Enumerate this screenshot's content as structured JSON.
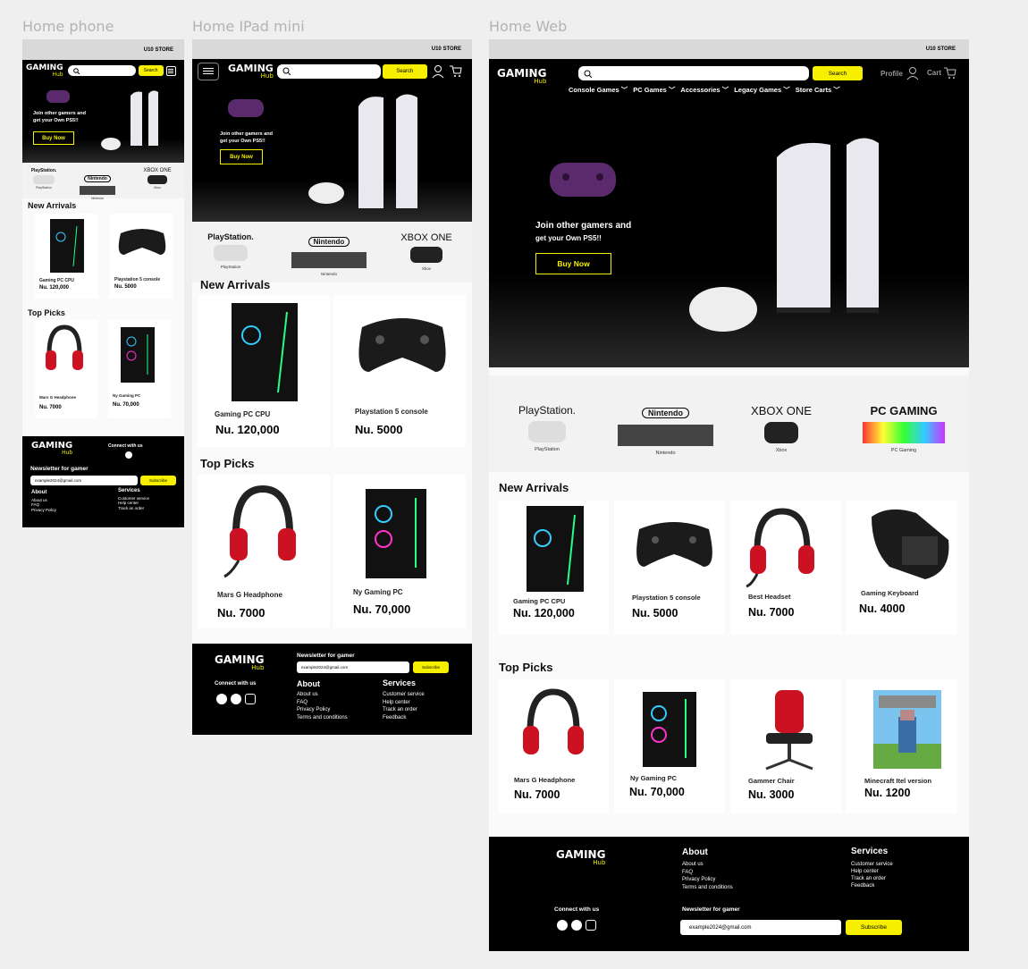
{
  "frames": {
    "phone_title": "Home phone",
    "ipad_title": "Home IPad mini",
    "web_title": "Home Web"
  },
  "store_name": "U10 STORE",
  "logo": {
    "main": "GAMING",
    "sub": "Hub"
  },
  "search_button": "Search",
  "hero": {
    "line1": "Join other gamers and",
    "line2": "get your Own PS5!!",
    "cta": "Buy Now"
  },
  "nav": {
    "profile": "Profile",
    "cart": "Cart",
    "menu": [
      "Console Games",
      "PC Games",
      "Accessories",
      "Legacy Games",
      "Store Carts"
    ]
  },
  "brands": [
    {
      "logo": "PlayStation.",
      "caption": "PlayStation"
    },
    {
      "logo": "Nintendo",
      "caption": "Nintendo"
    },
    {
      "logo": "XBOX ONE",
      "caption": "Xbox"
    },
    {
      "logo": "PC GAMING",
      "caption": "PC Gaming"
    }
  ],
  "sections": {
    "new_arrivals": "New Arrivals",
    "top_picks": "Top Picks"
  },
  "new_arrivals": [
    {
      "name": "Gaming PC CPU",
      "price": "Nu. 120,000",
      "icon": "gaming-pc-icon"
    },
    {
      "name": "Playstation 5 console",
      "price": "Nu. 5000",
      "icon": "controller-icon"
    },
    {
      "name": "Best Headset",
      "price": "Nu. 7000",
      "icon": "headset-icon"
    },
    {
      "name": "Gaming Keyboard",
      "price": "Nu. 4000",
      "icon": "keypad-icon"
    }
  ],
  "top_picks": [
    {
      "name": "Mars G Headphone",
      "price": "Nu. 7000",
      "icon": "headset-icon"
    },
    {
      "name": "Ny Gaming PC",
      "price": "Nu. 70,000",
      "icon": "gaming-pc-icon"
    },
    {
      "name": "Gammer Chair",
      "price": "Nu. 3000",
      "icon": "chair-icon"
    },
    {
      "name": "Minecraft Itel version",
      "price": "Nu. 1200",
      "icon": "minecraft-icon"
    }
  ],
  "footer": {
    "connect": "Connect with us",
    "newsletter": "Newsletter for gamer",
    "email": "example2024@gmail.com",
    "subscribe": "Subscribe",
    "about_title": "About",
    "about_links": [
      "About us",
      "FAQ",
      "Privacy Policy",
      "Terms and conditions"
    ],
    "phone_about_links": [
      "About us",
      "FAQ",
      "Privacy Policy"
    ],
    "services_title": "Services",
    "services_links": [
      "Customer service",
      "Help center",
      "Track an order",
      "Feedback"
    ],
    "phone_services_links": [
      "Customer service",
      "Help center",
      "Track an order"
    ]
  },
  "colors": {
    "accent": "#f6f000",
    "dark": "#000000",
    "frame_bg": "#fafafa",
    "page_bg": "#efefef"
  }
}
